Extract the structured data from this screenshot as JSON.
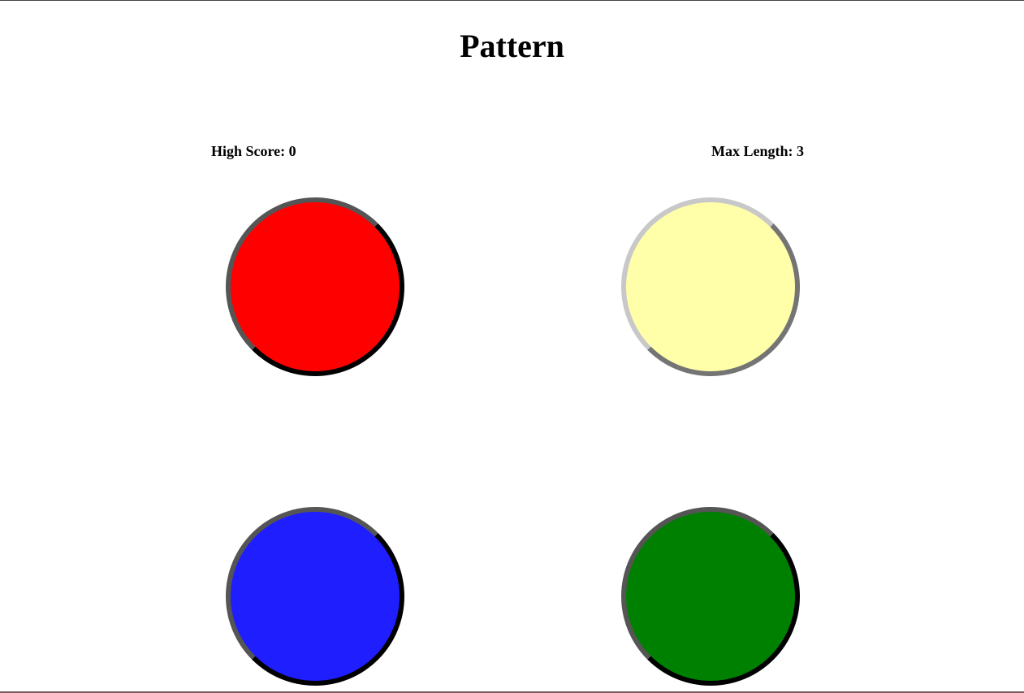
{
  "title": "Pattern",
  "stats": {
    "high_score": "High Score: 0",
    "max_length": "Max Length: 3"
  },
  "pads": [
    {
      "name": "red",
      "color": "#ff0000",
      "lit": true
    },
    {
      "name": "yellow",
      "color": "#ffffaa",
      "lit": false
    },
    {
      "name": "blue",
      "color": "#1e1eff",
      "lit": true
    },
    {
      "name": "green",
      "color": "#008000",
      "lit": true
    }
  ]
}
